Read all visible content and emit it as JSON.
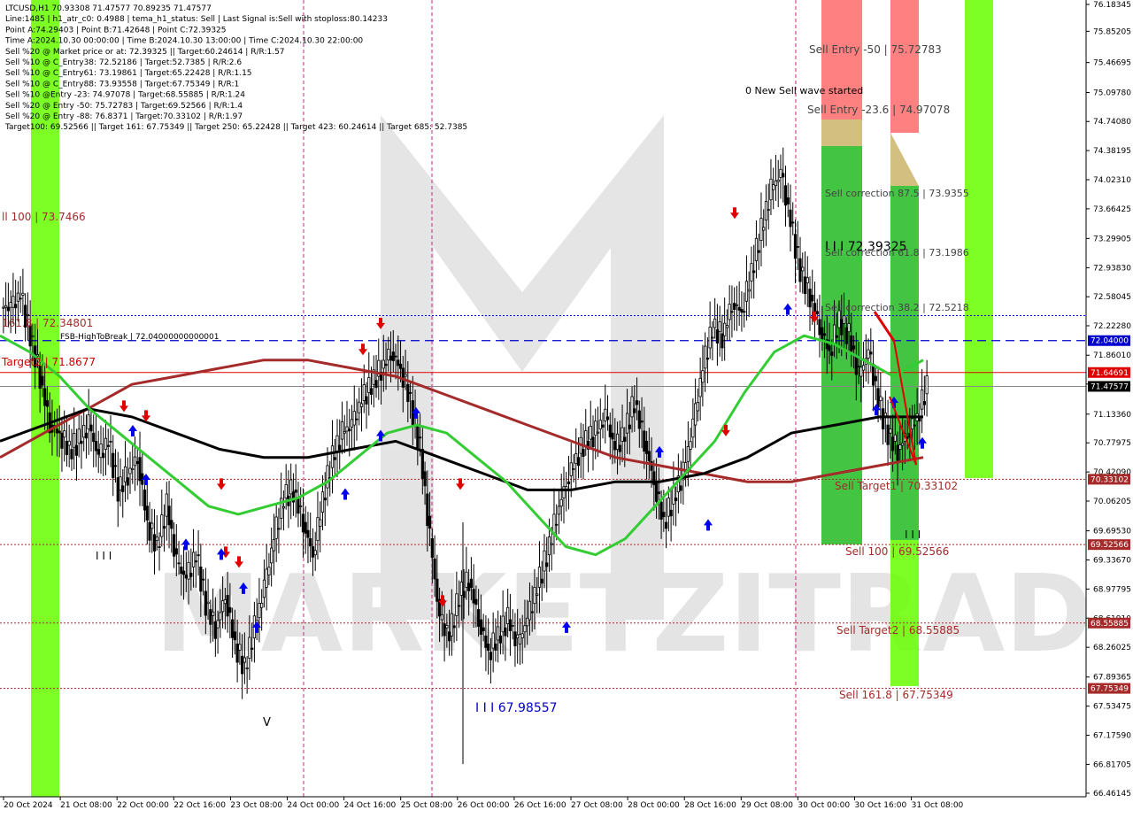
{
  "header": {
    "lines": [
      "LTCUSD,H1  70.93308 71.47577 70.89235 71.47577",
      "Line:1485 | h1_atr_c0: 0.4988 | tema_h1_status: Sell | Last Signal is:Sell with stoploss:80.14233",
      "Point A:74.29403 | Point B:71.42648 | Point C:72.39325",
      "Time A:2024.10.30 00:00:00 | Time B:2024.10.30 13:00:00 | Time C:2024.10.30 22:00:00",
      "Sell %20 @ Market price or at: 72.39325 || Target:60.24614 | R/R:1.57",
      "Sell %10 @ C_Entry38: 72.52186 | Target:52.7385 | R/R:2.6",
      "Sell %10 @ C_Entry61: 73.19861 | Target:65.22428 | R/R:1.15",
      "Sell %10 @ C_Entry88: 73.93558 | Target:67.75349 | R/R:1",
      "Sell %10 @Entry -23: 74.97078 | Target:68.55885 | R/R:1.24",
      "Sell %20 @ Entry -50: 75.72783 | Target:69.52566 | R/R:1.4",
      "Sell %20 @ Entry -88: 76.8371 | Target:70.33102 | R/R:1.97",
      "Target100: 69.52566 || Target 161: 67.75349 || Target 250: 65.22428 || Target 423: 60.24614 || Target 685: 52.7385"
    ]
  },
  "watermark": "MARKETZITRADE",
  "colors": {
    "bull_candle": "#000000",
    "ema_green": "#33cc33",
    "ema_darkred": "#a52a2a",
    "ema_black": "#000000",
    "red_line": "#e00000",
    "blue_dash": "#0000cc",
    "zone_green": "#22bb22",
    "zone_lime": "#66ff00",
    "zone_red": "#ff5555",
    "zone_tan": "#c8b060"
  },
  "annotations": {
    "sell_entry_50": "Sell Entry -50 | 75.72783",
    "new_sell_wave": "0 New Sell wave started",
    "sell_entry_23": "Sell Entry -23.6 | 74.97078",
    "sell_corr_875": "Sell correction 87.5 | 73.9355",
    "point_c": "I I I 72.39325",
    "sell_corr_618": "Sell correction 61.8 | 73.1986",
    "sell_corr_382": "Sell correction 38.2 | 72.5218",
    "ll100": "ll 100 | 73.7466",
    "fib1618": "161.8 | 72.34801",
    "fsb": "FSB-HighToBreak | 72.04000000000001",
    "target2_left": "Target2 | 71.8677",
    "sell_target1": "Sell Target1 | 70.33102",
    "sell100": "Sell 100 | 69.52566",
    "sell_target2": "Sell Target2 | 68.55885",
    "sell1618": "Sell 161.8 | 67.75349",
    "low_label": "I I I 67.98557",
    "mark_iii_left": "I I I",
    "mark_iii_right": "I I I",
    "mark_v": "V"
  },
  "price_tags": {
    "fsb": "72.04000",
    "red": "71.64691",
    "current": "71.47577",
    "t1": "70.33102",
    "t100": "69.52566",
    "t2": "68.55885",
    "t1618": "67.75349"
  },
  "chart_data": {
    "type": "candlestick",
    "symbol": "LTCUSD",
    "timeframe": "H1",
    "ylim": [
      66.46145,
      76.18345
    ],
    "y_ticks": [
      "76.18345",
      "75.85205",
      "75.46695",
      "75.09780",
      "74.74080",
      "74.38195",
      "74.02310",
      "73.66425",
      "73.29905",
      "72.93830",
      "72.58045",
      "72.22280",
      "71.86010",
      "71.50475",
      "71.13360",
      "70.77975",
      "70.42090",
      "70.06205",
      "69.69530",
      "69.33670",
      "68.97795",
      "68.61910",
      "68.26025",
      "67.89365",
      "67.53475",
      "67.17590",
      "66.81705",
      "66.46145"
    ],
    "x_ticks": [
      "20 Oct 2024",
      "21 Oct 08:00",
      "22 Oct 00:00",
      "22 Oct 16:00",
      "23 Oct 08:00",
      "24 Oct 00:00",
      "24 Oct 16:00",
      "25 Oct 08:00",
      "26 Oct 00:00",
      "26 Oct 16:00",
      "27 Oct 08:00",
      "28 Oct 00:00",
      "28 Oct 16:00",
      "29 Oct 08:00",
      "30 Oct 00:00",
      "30 Oct 16:00",
      "31 Oct 08:00"
    ],
    "key_levels": {
      "fsb_high_to_break": 72.04,
      "red_level": 71.64691,
      "current": 71.47577,
      "fib_1618_left": 72.34801,
      "target2_left": 71.8677,
      "sell_target1": 70.33102,
      "sell_100": 69.52566,
      "sell_target2": 68.55885,
      "sell_1618": 67.75349,
      "sell_entry_50": 75.72783,
      "sell_entry_236": 74.97078,
      "sell_corr_875": 73.9355,
      "sell_corr_618": 73.1986,
      "sell_corr_382": 72.5218,
      "point_c": 72.39325,
      "low": 67.98557
    },
    "close_path": [
      72.45,
      72.6,
      72.1,
      71.6,
      71.0,
      70.9,
      70.7,
      70.8,
      71.0,
      70.6,
      70.8,
      70.2,
      70.4,
      70.6,
      69.8,
      69.5,
      70.0,
      69.3,
      69.1,
      69.4,
      68.8,
      68.5,
      68.9,
      68.3,
      68.0,
      68.5,
      69.0,
      69.6,
      70.1,
      70.2,
      69.8,
      69.4,
      70.1,
      70.6,
      70.9,
      71.0,
      71.3,
      71.5,
      71.7,
      71.9,
      71.7,
      71.3,
      70.7,
      69.6,
      68.6,
      68.4,
      68.9,
      69.1,
      68.6,
      68.2,
      68.4,
      68.6,
      68.3,
      68.6,
      69.0,
      69.4,
      69.9,
      70.3,
      70.6,
      70.8,
      70.9,
      71.1,
      70.7,
      70.9,
      71.3,
      70.8,
      70.3,
      69.8,
      70.1,
      70.4,
      71.0,
      71.7,
      72.2,
      72.1,
      72.5,
      72.4,
      72.9,
      73.4,
      73.9,
      74.1,
      73.5,
      72.9,
      72.6,
      72.2,
      71.9,
      72.3,
      72.1,
      71.6,
      71.9,
      71.3,
      70.9,
      70.7,
      70.9,
      71.1,
      71.48
    ],
    "ema_green_path": [
      72.1,
      71.9,
      71.6,
      71.2,
      70.9,
      70.6,
      70.3,
      70.0,
      69.9,
      70.0,
      70.1,
      70.3,
      70.6,
      70.9,
      71.0,
      70.9,
      70.6,
      70.3,
      69.9,
      69.5,
      69.4,
      69.6,
      70.0,
      70.4,
      70.8,
      71.4,
      71.9,
      72.1,
      72.0,
      71.8,
      71.6,
      71.8
    ],
    "ema_darkred_path": [
      70.6,
      70.9,
      71.2,
      71.5,
      71.6,
      71.7,
      71.8,
      71.8,
      71.7,
      71.6,
      71.4,
      71.2,
      71.0,
      70.8,
      70.6,
      70.5,
      70.4,
      70.3,
      70.3,
      70.4,
      70.5,
      70.6
    ],
    "ema_black_path": [
      70.8,
      71.0,
      71.2,
      71.1,
      70.9,
      70.7,
      70.6,
      70.6,
      70.7,
      70.8,
      70.6,
      70.4,
      70.2,
      70.2,
      70.3,
      70.3,
      70.4,
      70.6,
      70.9,
      71.0,
      71.1,
      71.1
    ],
    "sell_arrows": [
      [
        140,
        71.16
      ],
      [
        165,
        71.04
      ],
      [
        250,
        70.2
      ],
      [
        255,
        69.36
      ],
      [
        270,
        69.24
      ],
      [
        410,
        71.86
      ],
      [
        430,
        72.18
      ],
      [
        500,
        68.76
      ],
      [
        520,
        70.2
      ],
      [
        820,
        70.86
      ],
      [
        830,
        73.54
      ],
      [
        920,
        72.26
      ]
    ],
    "buy_arrows": [
      [
        150,
        71.0
      ],
      [
        165,
        70.4
      ],
      [
        210,
        69.6
      ],
      [
        250,
        69.48
      ],
      [
        275,
        69.06
      ],
      [
        290,
        68.58
      ],
      [
        390,
        70.22
      ],
      [
        430,
        70.94
      ],
      [
        470,
        71.22
      ],
      [
        640,
        68.58
      ],
      [
        745,
        70.74
      ],
      [
        800,
        69.84
      ],
      [
        890,
        72.5
      ],
      [
        990,
        71.26
      ],
      [
        1010,
        71.35
      ],
      [
        1042,
        70.85
      ]
    ]
  }
}
